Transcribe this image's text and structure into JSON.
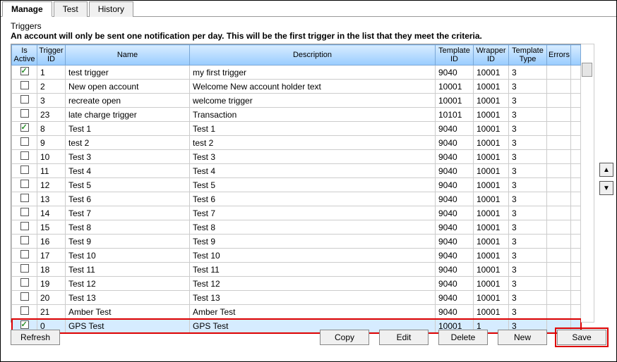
{
  "tabs": {
    "manage": "Manage",
    "test": "Test",
    "history": "History"
  },
  "section": {
    "title": "Triggers",
    "note": "An account will only be sent one notification per day.  This will be the first trigger in the list that they meet the criteria."
  },
  "columns": {
    "is_active": "Is Active",
    "trigger_id": "Trigger ID",
    "name": "Name",
    "description": "Description",
    "template_id": "Template ID",
    "wrapper_id": "Wrapper ID",
    "template_type": "Template Type",
    "errors": "Errors"
  },
  "rows": [
    {
      "active": true,
      "trigger_id": "1",
      "name": "test trigger",
      "description": "my first trigger",
      "template_id": "9040",
      "wrapper_id": "10001",
      "template_type": "3",
      "errors": "",
      "selected": false
    },
    {
      "active": false,
      "trigger_id": "2",
      "name": "New open account",
      "description": "Welcome New account holder text",
      "template_id": "10001",
      "wrapper_id": "10001",
      "template_type": "3",
      "errors": "",
      "selected": false
    },
    {
      "active": false,
      "trigger_id": "3",
      "name": "recreate open",
      "description": "welcome trigger",
      "template_id": "10001",
      "wrapper_id": "10001",
      "template_type": "3",
      "errors": "",
      "selected": false
    },
    {
      "active": false,
      "trigger_id": "23",
      "name": "late charge trigger",
      "description": "Transaction",
      "template_id": "10101",
      "wrapper_id": "10001",
      "template_type": "3",
      "errors": "",
      "selected": false
    },
    {
      "active": true,
      "trigger_id": "8",
      "name": "Test 1",
      "description": "Test 1",
      "template_id": "9040",
      "wrapper_id": "10001",
      "template_type": "3",
      "errors": "",
      "selected": false
    },
    {
      "active": false,
      "trigger_id": "9",
      "name": "test 2",
      "description": "test 2",
      "template_id": "9040",
      "wrapper_id": "10001",
      "template_type": "3",
      "errors": "",
      "selected": false
    },
    {
      "active": false,
      "trigger_id": "10",
      "name": "Test 3",
      "description": "Test 3",
      "template_id": "9040",
      "wrapper_id": "10001",
      "template_type": "3",
      "errors": "",
      "selected": false
    },
    {
      "active": false,
      "trigger_id": "11",
      "name": "Test 4",
      "description": "Test 4",
      "template_id": "9040",
      "wrapper_id": "10001",
      "template_type": "3",
      "errors": "",
      "selected": false
    },
    {
      "active": false,
      "trigger_id": "12",
      "name": "Test 5",
      "description": "Test 5",
      "template_id": "9040",
      "wrapper_id": "10001",
      "template_type": "3",
      "errors": "",
      "selected": false
    },
    {
      "active": false,
      "trigger_id": "13",
      "name": "Test 6",
      "description": "Test 6",
      "template_id": "9040",
      "wrapper_id": "10001",
      "template_type": "3",
      "errors": "",
      "selected": false
    },
    {
      "active": false,
      "trigger_id": "14",
      "name": "Test 7",
      "description": "Test 7",
      "template_id": "9040",
      "wrapper_id": "10001",
      "template_type": "3",
      "errors": "",
      "selected": false
    },
    {
      "active": false,
      "trigger_id": "15",
      "name": "Test 8",
      "description": "Test 8",
      "template_id": "9040",
      "wrapper_id": "10001",
      "template_type": "3",
      "errors": "",
      "selected": false
    },
    {
      "active": false,
      "trigger_id": "16",
      "name": "Test 9",
      "description": "Test 9",
      "template_id": "9040",
      "wrapper_id": "10001",
      "template_type": "3",
      "errors": "",
      "selected": false
    },
    {
      "active": false,
      "trigger_id": "17",
      "name": "Test 10",
      "description": "Test 10",
      "template_id": "9040",
      "wrapper_id": "10001",
      "template_type": "3",
      "errors": "",
      "selected": false
    },
    {
      "active": false,
      "trigger_id": "18",
      "name": "Test 11",
      "description": "Test 11",
      "template_id": "9040",
      "wrapper_id": "10001",
      "template_type": "3",
      "errors": "",
      "selected": false
    },
    {
      "active": false,
      "trigger_id": "19",
      "name": "Test 12",
      "description": "Test 12",
      "template_id": "9040",
      "wrapper_id": "10001",
      "template_type": "3",
      "errors": "",
      "selected": false
    },
    {
      "active": false,
      "trigger_id": "20",
      "name": "Test 13",
      "description": "Test 13",
      "template_id": "9040",
      "wrapper_id": "10001",
      "template_type": "3",
      "errors": "",
      "selected": false
    },
    {
      "active": false,
      "trigger_id": "21",
      "name": "Amber Test",
      "description": "Amber Test",
      "template_id": "9040",
      "wrapper_id": "10001",
      "template_type": "3",
      "errors": "",
      "selected": false
    },
    {
      "active": true,
      "trigger_id": "0",
      "name": "GPS Test",
      "description": "GPS Test",
      "template_id": "10001",
      "wrapper_id": "1",
      "template_type": "3",
      "errors": "",
      "selected": true
    }
  ],
  "buttons": {
    "refresh": "Refresh",
    "copy": "Copy",
    "edit": "Edit",
    "delete": "Delete",
    "new": "New",
    "save": "Save"
  },
  "arrows": {
    "up": "▲",
    "down": "▼"
  }
}
